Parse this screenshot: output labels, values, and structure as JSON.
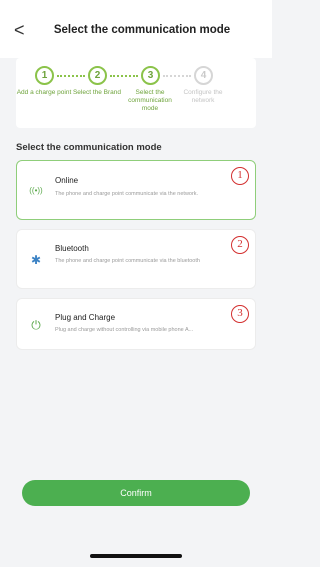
{
  "header": {
    "back_icon": "chevron-left-icon",
    "back_glyph": "<",
    "title": "Select the communication mode"
  },
  "stepper": {
    "steps": [
      {
        "number": "1",
        "label": "Add a charge point",
        "state": "done"
      },
      {
        "number": "2",
        "label": "Select the Brand",
        "state": "done"
      },
      {
        "number": "3",
        "label": "Select the communication mode",
        "state": "current"
      },
      {
        "number": "4",
        "label": "Configure the network",
        "state": "pending"
      }
    ]
  },
  "section": {
    "label": "Select the communication mode"
  },
  "modes": [
    {
      "title": "Online",
      "description": "The phone and charge point communicate via the network.",
      "icon": "wifi-signal-icon",
      "glyph": "((•))",
      "annotation": "1",
      "selected": true
    },
    {
      "title": "Bluetooth",
      "description": "The phone and charge point communicate via the bluetooth",
      "icon": "bluetooth-icon",
      "glyph": "✱",
      "annotation": "2",
      "selected": false
    },
    {
      "title": "Plug and Charge",
      "description": "Plug and charge without controlling via mobile phone A...",
      "icon": "plug-icon",
      "glyph": "⏻",
      "annotation": "3",
      "selected": false
    }
  ],
  "footer": {
    "confirm_label": "Confirm"
  },
  "colors": {
    "accent": "#4caf50",
    "step_active": "#8bc34a",
    "annotation": "#d32f2f"
  }
}
